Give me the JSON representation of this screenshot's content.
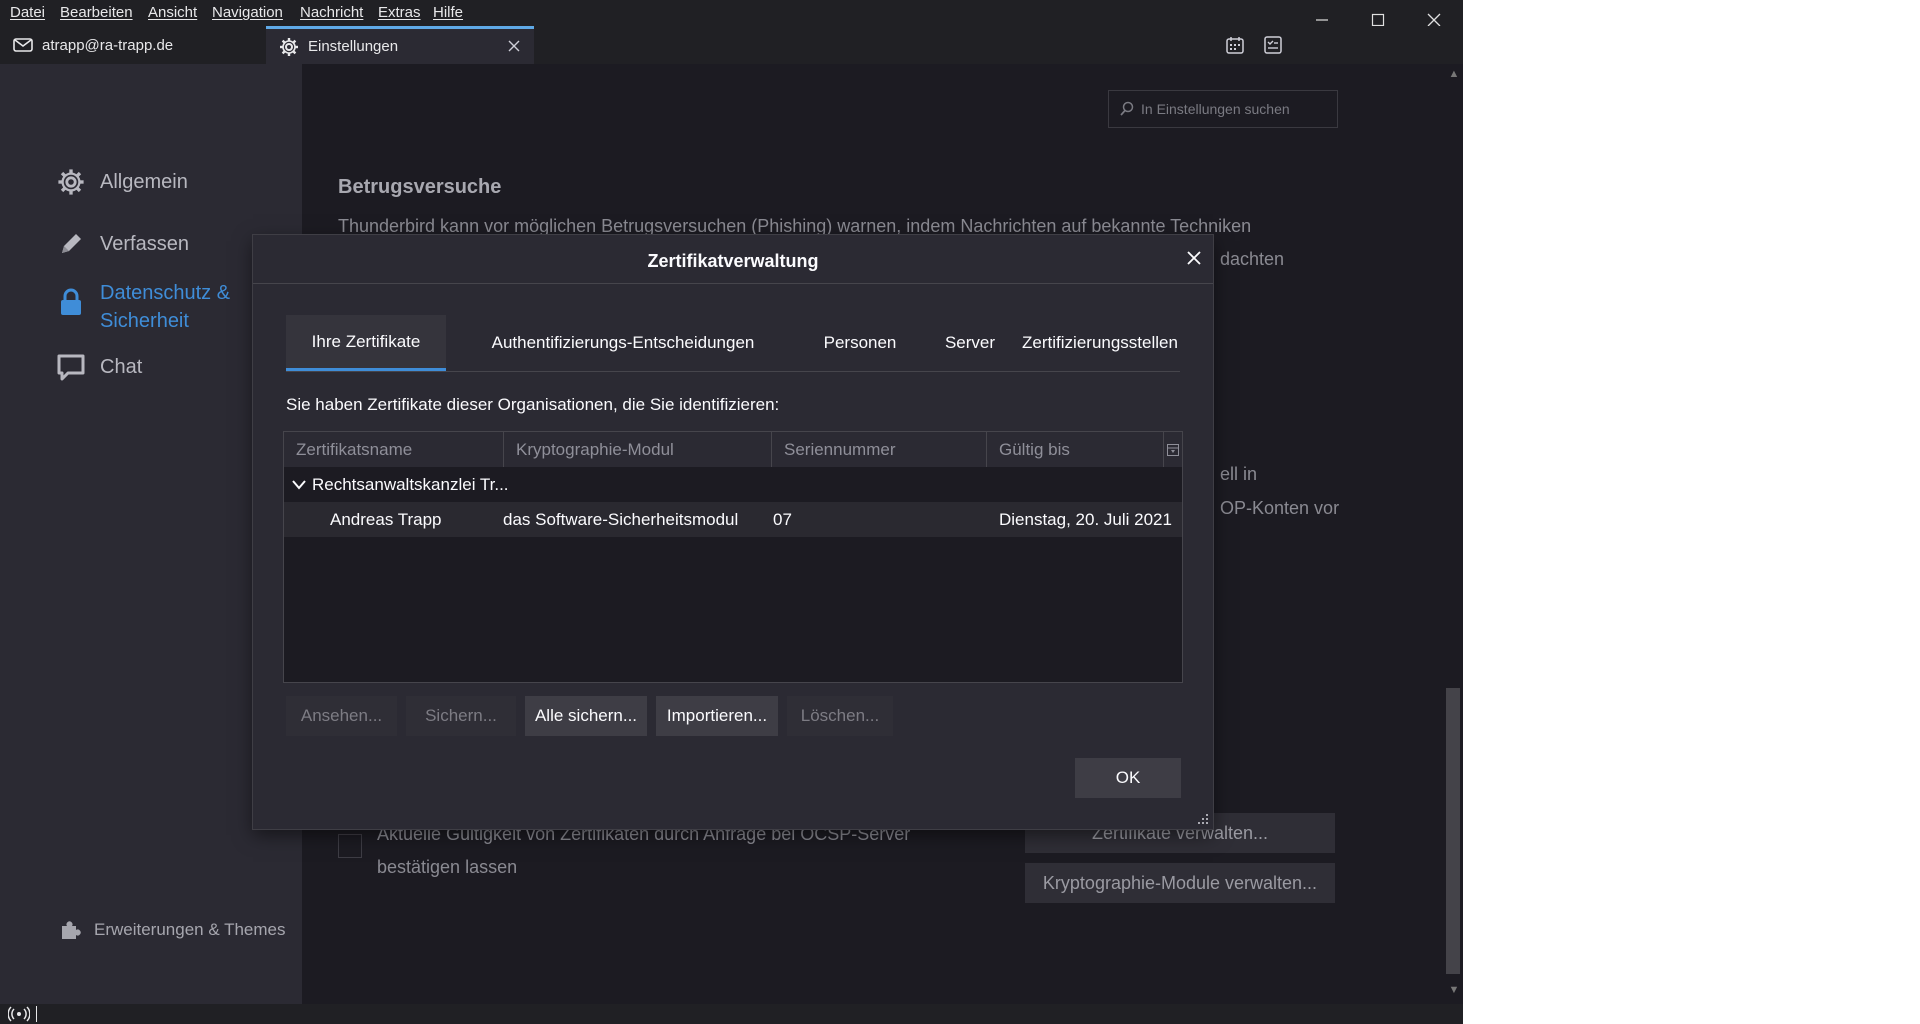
{
  "menubar": {
    "items": [
      "Datei",
      "Bearbeiten",
      "Ansicht",
      "Navigation",
      "Nachricht",
      "Extras",
      "Hilfe"
    ]
  },
  "tabs": [
    {
      "label": "atrapp@ra-trapp.de",
      "icon": "mail-icon"
    },
    {
      "label": "Einstellungen",
      "icon": "gear-icon"
    }
  ],
  "sidebar": {
    "items": [
      {
        "label": "Allgemein",
        "icon": "gear-icon"
      },
      {
        "label": "Verfassen",
        "icon": "pencil-icon"
      },
      {
        "label": "Datenschutz &",
        "label2": "Sicherheit",
        "icon": "lock-icon",
        "active": true
      },
      {
        "label": "Chat",
        "icon": "chat-icon"
      }
    ],
    "extensions": "Erweiterungen & Themes"
  },
  "content": {
    "search_placeholder": "In Einstellungen suchen",
    "section_title": "Betrugsversuche",
    "line1": "Thunderbird kann vor möglichen Betrugsversuchen (Phishing) warnen, indem Nachrichten auf bekannte Techniken",
    "line2_tail": "dachten",
    "line3_tail": "ell in",
    "line4_tail": "OP-Konten vor",
    "ocsp_line1": "Aktuelle Gültigkeit von Zertifikaten durch Anfrage bei OCSP-Server",
    "ocsp_line2": "bestätigen lassen",
    "manage_certs": "Zertifikate verwalten...",
    "manage_modules": "Kryptographie-Module verwalten..."
  },
  "dialog": {
    "title": "Zertifikatverwaltung",
    "tabs": [
      "Ihre Zertifikate",
      "Authentifizierungs-Entscheidungen",
      "Personen",
      "Server",
      "Zertifizierungsstellen"
    ],
    "description": "Sie haben Zertifikate dieser Organisationen, die Sie identifizieren:",
    "columns": [
      "Zertifikatsname",
      "Kryptographie-Modul",
      "Seriennummer",
      "Gültig bis"
    ],
    "group": "Rechtsanwaltskanzlei Tr...",
    "rows": [
      {
        "name": "Andreas Trapp",
        "module": "das Software-Sicherheitsmodul",
        "serial": "07",
        "valid_until": "Dienstag, 20. Juli 2021"
      }
    ],
    "buttons": {
      "view": "Ansehen...",
      "backup": "Sichern...",
      "backup_all": "Alle sichern...",
      "import": "Importieren...",
      "delete": "Löschen..."
    },
    "ok": "OK"
  },
  "colors": {
    "accent": "#3f8dd8",
    "background": "#1c1b22",
    "panel": "#2b2a33"
  }
}
